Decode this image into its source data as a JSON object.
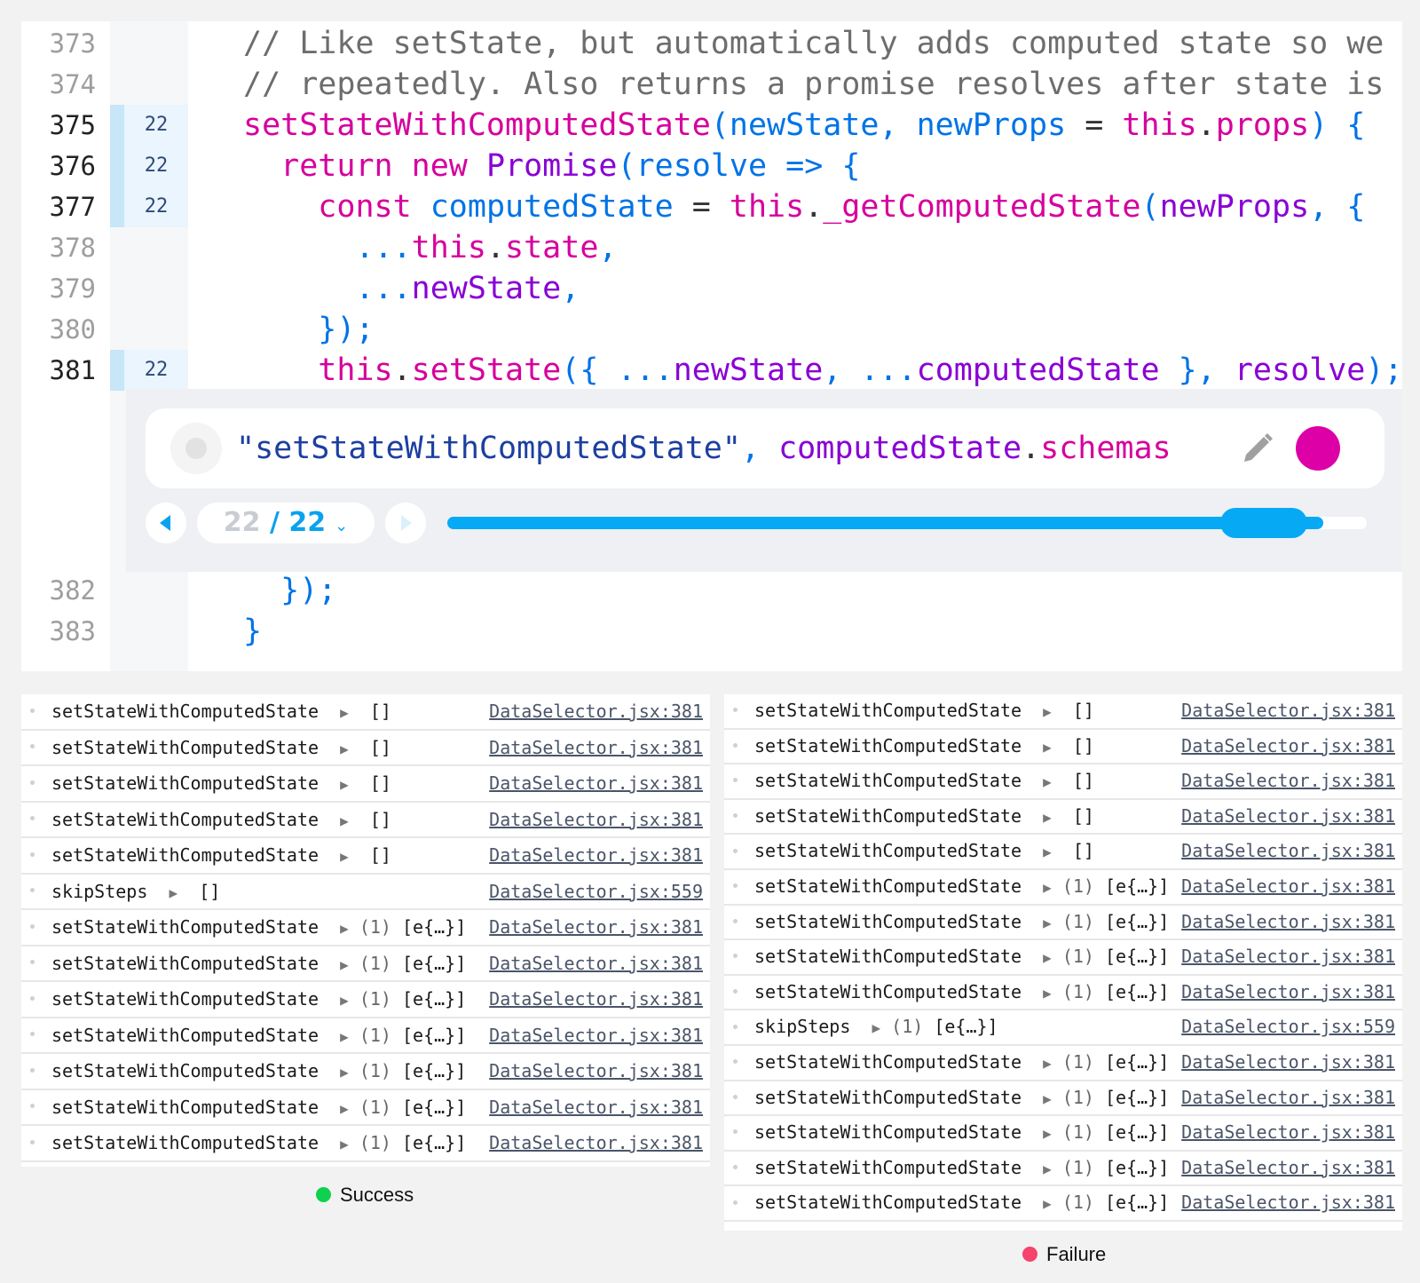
{
  "editor": {
    "lines": [
      {
        "num": "373",
        "hits": "",
        "hit": false
      },
      {
        "num": "374",
        "hits": "",
        "hit": false
      },
      {
        "num": "375",
        "hits": "22",
        "hit": true
      },
      {
        "num": "376",
        "hits": "22",
        "hit": true
      },
      {
        "num": "377",
        "hits": "22",
        "hit": true
      },
      {
        "num": "378",
        "hits": "",
        "hit": false
      },
      {
        "num": "379",
        "hits": "",
        "hit": false
      },
      {
        "num": "380",
        "hits": "",
        "hit": false
      },
      {
        "num": "381",
        "hits": "22",
        "hit": true
      },
      {
        "num": "382",
        "hits": "",
        "hit": false
      },
      {
        "num": "383",
        "hits": "",
        "hit": false
      }
    ],
    "code": {
      "l373": "// Like setState, but automatically adds computed state so we",
      "l374": "// repeatedly. Also returns a promise resolves after state is",
      "l375": [
        "setStateWithComputedState",
        "(",
        "newState",
        ", ",
        "newProps",
        " = ",
        "this",
        ".",
        "props",
        ") {"
      ],
      "l376": [
        "return new ",
        "Promise",
        "(",
        "resolve",
        " => {"
      ],
      "l377": [
        "const ",
        "computedState",
        " = ",
        "this",
        ".",
        "_getComputedState",
        "(",
        "newProps",
        ", {"
      ],
      "l378": [
        "...",
        "this",
        ".",
        "state",
        ","
      ],
      "l379": [
        "...",
        "newState",
        ","
      ],
      "l380": "});",
      "l381": [
        "this",
        ".",
        "setState",
        "({ ...",
        "newState",
        ", ...",
        "computedState",
        " }, ",
        "resolve",
        ");"
      ],
      "l382": "});",
      "l383": "}"
    }
  },
  "logpoint": {
    "expr_string": "\"setStateWithComputedState\"",
    "expr_sep": ", ",
    "expr_obj": "computedState",
    "expr_dot": ".",
    "expr_prop": "schemas",
    "edit_icon": "pencil-icon",
    "marker_color": "#dd00a7",
    "counter_current": "22",
    "counter_sep": " / ",
    "counter_total": "22",
    "counter_chevron": "⌄",
    "prev_icon": "triangle-left-icon",
    "next_icon": "triangle-right-icon",
    "timeline_progress": 0.953
  },
  "consoles": {
    "success": {
      "label": "Success",
      "color": "#0fd14f",
      "rows": [
        {
          "name": "setStateWithComputedState",
          "count": "",
          "value": "[]",
          "src": "DataSelector.jsx:381"
        },
        {
          "name": "setStateWithComputedState",
          "count": "",
          "value": "[]",
          "src": "DataSelector.jsx:381"
        },
        {
          "name": "setStateWithComputedState",
          "count": "",
          "value": "[]",
          "src": "DataSelector.jsx:381"
        },
        {
          "name": "setStateWithComputedState",
          "count": "",
          "value": "[]",
          "src": "DataSelector.jsx:381"
        },
        {
          "name": "setStateWithComputedState",
          "count": "",
          "value": "[]",
          "src": "DataSelector.jsx:381"
        },
        {
          "name": "skipSteps",
          "count": "",
          "value": "[]",
          "src": "DataSelector.jsx:559"
        },
        {
          "name": "setStateWithComputedState",
          "count": "(1)",
          "value": "[e{…}]",
          "src": "DataSelector.jsx:381"
        },
        {
          "name": "setStateWithComputedState",
          "count": "(1)",
          "value": "[e{…}]",
          "src": "DataSelector.jsx:381"
        },
        {
          "name": "setStateWithComputedState",
          "count": "(1)",
          "value": "[e{…}]",
          "src": "DataSelector.jsx:381"
        },
        {
          "name": "setStateWithComputedState",
          "count": "(1)",
          "value": "[e{…}]",
          "src": "DataSelector.jsx:381"
        },
        {
          "name": "setStateWithComputedState",
          "count": "(1)",
          "value": "[e{…}]",
          "src": "DataSelector.jsx:381"
        },
        {
          "name": "setStateWithComputedState",
          "count": "(1)",
          "value": "[e{…}]",
          "src": "DataSelector.jsx:381"
        },
        {
          "name": "setStateWithComputedState",
          "count": "(1)",
          "value": "[e{…}]",
          "src": "DataSelector.jsx:381"
        }
      ]
    },
    "failure": {
      "label": "Failure",
      "color": "#f5436b",
      "rows": [
        {
          "name": "setStateWithComputedState",
          "count": "",
          "value": "[]",
          "src": "DataSelector.jsx:381"
        },
        {
          "name": "setStateWithComputedState",
          "count": "",
          "value": "[]",
          "src": "DataSelector.jsx:381"
        },
        {
          "name": "setStateWithComputedState",
          "count": "",
          "value": "[]",
          "src": "DataSelector.jsx:381"
        },
        {
          "name": "setStateWithComputedState",
          "count": "",
          "value": "[]",
          "src": "DataSelector.jsx:381"
        },
        {
          "name": "setStateWithComputedState",
          "count": "",
          "value": "[]",
          "src": "DataSelector.jsx:381"
        },
        {
          "name": "setStateWithComputedState",
          "count": "(1)",
          "value": "[e{…}]",
          "src": "DataSelector.jsx:381"
        },
        {
          "name": "setStateWithComputedState",
          "count": "(1)",
          "value": "[e{…}]",
          "src": "DataSelector.jsx:381"
        },
        {
          "name": "setStateWithComputedState",
          "count": "(1)",
          "value": "[e{…}]",
          "src": "DataSelector.jsx:381"
        },
        {
          "name": "setStateWithComputedState",
          "count": "(1)",
          "value": "[e{…}]",
          "src": "DataSelector.jsx:381"
        },
        {
          "name": "skipSteps",
          "count": "(1)",
          "value": "[e{…}]",
          "src": "DataSelector.jsx:559"
        },
        {
          "name": "setStateWithComputedState",
          "count": "(1)",
          "value": "[e{…}]",
          "src": "DataSelector.jsx:381"
        },
        {
          "name": "setStateWithComputedState",
          "count": "(1)",
          "value": "[e{…}]",
          "src": "DataSelector.jsx:381"
        },
        {
          "name": "setStateWithComputedState",
          "count": "(1)",
          "value": "[e{…}]",
          "src": "DataSelector.jsx:381"
        },
        {
          "name": "setStateWithComputedState",
          "count": "(1)",
          "value": "[e{…}]",
          "src": "DataSelector.jsx:381"
        },
        {
          "name": "setStateWithComputedState",
          "count": "(1)",
          "value": "[e{…}]",
          "src": "DataSelector.jsx:381"
        }
      ]
    }
  }
}
